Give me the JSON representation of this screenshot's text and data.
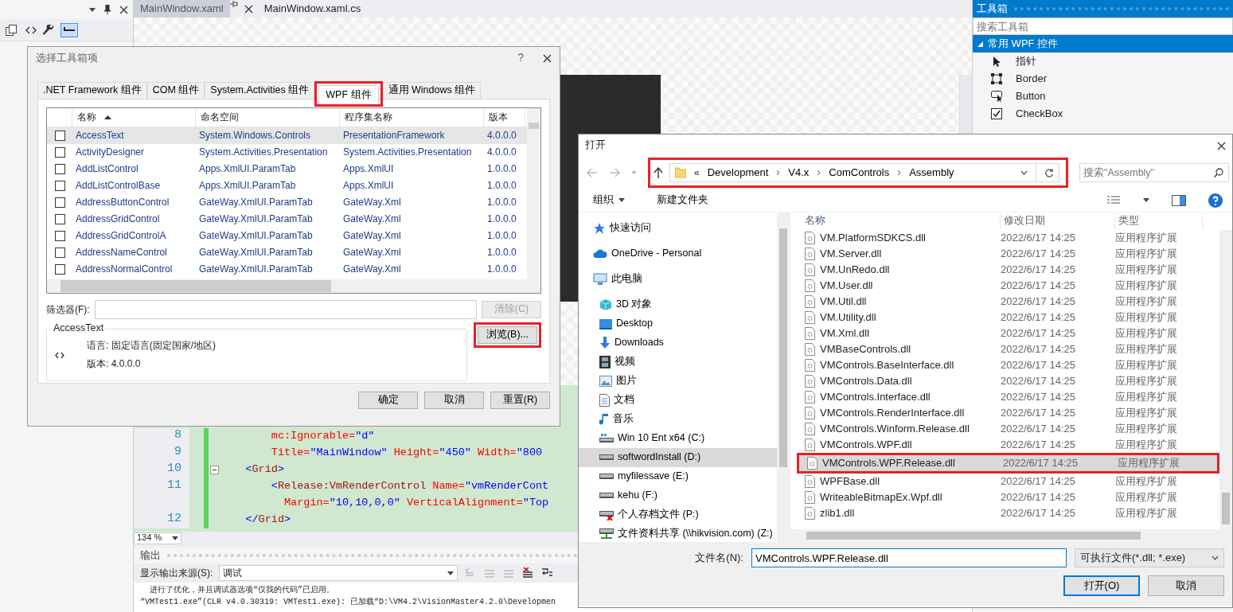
{
  "ide": {
    "editor_tabs": [
      {
        "label": "MainWindow.xaml",
        "selected": true
      },
      {
        "label": "MainWindow.xaml.cs",
        "selected": false
      }
    ],
    "code_lines": [
      {
        "number": "8",
        "fold": false,
        "segments": [
          {
            "kind": "attr",
            "text": "        mc:Ignorable="
          },
          {
            "kind": "value",
            "text": "\"d\""
          }
        ]
      },
      {
        "number": "9",
        "fold": false,
        "segments": [
          {
            "kind": "attr",
            "text": "        Title="
          },
          {
            "kind": "value",
            "text": "\"MainWindow\""
          },
          {
            "kind": "attr",
            "text": " Height="
          },
          {
            "kind": "value",
            "text": "\"450\""
          },
          {
            "kind": "attr",
            "text": " Width="
          },
          {
            "kind": "value",
            "text": "\"800"
          }
        ]
      },
      {
        "number": "10",
        "fold": true,
        "segments": [
          {
            "kind": "bracket",
            "text": "    <"
          },
          {
            "kind": "tag",
            "text": "Grid"
          },
          {
            "kind": "bracket",
            "text": ">"
          }
        ]
      },
      {
        "number": "11",
        "fold": false,
        "segments": [
          {
            "kind": "bracket",
            "text": "        <"
          },
          {
            "kind": "tag",
            "text": "Release:VmRenderControl"
          },
          {
            "kind": "attr",
            "text": " Name="
          },
          {
            "kind": "value",
            "text": "\"vmRenderCont"
          }
        ]
      },
      {
        "fold": false,
        "segments": [
          {
            "kind": "attr",
            "text": "          Margin="
          },
          {
            "kind": "value",
            "text": "\"10,10,0,0\""
          },
          {
            "kind": "attr",
            "text": " VerticalAlignment="
          },
          {
            "kind": "value",
            "text": "\"Top"
          }
        ]
      },
      {
        "number": "12",
        "fold": false,
        "segments": [
          {
            "kind": "bracket",
            "text": "    </"
          },
          {
            "kind": "tag",
            "text": "Grid"
          },
          {
            "kind": "bracket",
            "text": ">"
          }
        ]
      }
    ],
    "zoom": "134 %",
    "output": {
      "title": "输出",
      "source_label": "显示输出来源(S):",
      "source_value": "调试",
      "lines": [
        "  进行了优化，并且调试器选项“仅我的代码”已启用。",
        "“VMTest1.exe”(CLR v4.0.30319: VMTest1.exe): 已加载“D:\\VM4.2\\VisionMaster4.2.0\\Developmen"
      ]
    },
    "toolbox": {
      "title": "工具箱",
      "search_placeholder": "搜索工具箱",
      "group": {
        "label": "常用 WPF 控件",
        "expanded": true
      },
      "items": [
        {
          "label": "指针"
        },
        {
          "label": "Border"
        },
        {
          "label": "Button"
        },
        {
          "label": "CheckBox"
        }
      ]
    }
  },
  "choose_items_dialog": {
    "title": "选择工具箱项",
    "help": "?",
    "tabs": [
      {
        "label": ".NET Framework 组件",
        "selected": false,
        "highlighted": false
      },
      {
        "label": "COM 组件",
        "selected": false,
        "highlighted": false
      },
      {
        "label": "System.Activities 组件",
        "selected": false,
        "highlighted": false
      },
      {
        "label": "WPF 组件",
        "selected": true,
        "highlighted": true
      },
      {
        "label": "通用 Windows 组件",
        "selected": false,
        "highlighted": false
      }
    ],
    "columns": [
      "名称",
      "命名空间",
      "程序集名称",
      "版本"
    ],
    "rows": [
      {
        "checked": false,
        "selected": true,
        "name": "AccessText",
        "namespace": "System.Windows.Controls",
        "assembly": "PresentationFramework",
        "version": "4.0.0.0"
      },
      {
        "checked": false,
        "selected": false,
        "name": "ActivityDesigner",
        "namespace": "System.Activities.Presentation",
        "assembly": "System.Activities.Presentation",
        "version": "4.0.0.0"
      },
      {
        "checked": false,
        "selected": false,
        "name": "AddListControl",
        "namespace": "Apps.XmlUI.ParamTab",
        "assembly": "Apps.XmlUI",
        "version": "1.0.0.0"
      },
      {
        "checked": false,
        "selected": false,
        "name": "AddListControlBase",
        "namespace": "Apps.XmlUI.ParamTab",
        "assembly": "Apps.XmlUI",
        "version": "1.0.0.0"
      },
      {
        "checked": false,
        "selected": false,
        "name": "AddressButtonControl",
        "namespace": "GateWay.XmlUI.ParamTab",
        "assembly": "GateWay.Xml",
        "version": "1.0.0.0"
      },
      {
        "checked": false,
        "selected": false,
        "name": "AddressGridControl",
        "namespace": "GateWay.XmlUI.ParamTab",
        "assembly": "GateWay.Xml",
        "version": "1.0.0.0"
      },
      {
        "checked": false,
        "selected": false,
        "name": "AddressGridControlA",
        "namespace": "GateWay.XmlUI.ParamTab",
        "assembly": "GateWay.Xml",
        "version": "1.0.0.0"
      },
      {
        "checked": false,
        "selected": false,
        "name": "AddressNameControl",
        "namespace": "GateWay.XmlUI.ParamTab",
        "assembly": "GateWay.Xml",
        "version": "1.0.0.0"
      },
      {
        "checked": false,
        "selected": false,
        "name": "AddressNormalControl",
        "namespace": "GateWay.XmlUI.ParamTab",
        "assembly": "GateWay.Xml",
        "version": "1.0.0.0"
      }
    ],
    "filter_label": "筛选器(F):",
    "clear_button": {
      "label": "清除(C)",
      "disabled": true
    },
    "browse_button": {
      "label": "浏览(B)...",
      "highlighted": true
    },
    "info": {
      "title": "AccessText",
      "language": "语言: 固定语言(固定国家/地区)",
      "version": "版本: 4.0.0.0"
    },
    "buttons": [
      "确定",
      "取消",
      "重置(R)"
    ]
  },
  "open_dialog": {
    "title": "打开",
    "path": {
      "prefix": "«",
      "crumbs": [
        "Development",
        "V4.x",
        "ComControls",
        "Assembly"
      ],
      "highlighted": true
    },
    "search_placeholder": "搜索\"Assembly\"",
    "toolbar": {
      "organize": "组织",
      "new_folder": "新建文件夹"
    },
    "nav": [
      {
        "label": "快速访问",
        "selected": false
      },
      {
        "label": "OneDrive - Personal",
        "selected": false
      },
      {
        "label": "此电脑",
        "selected": false,
        "children": [
          {
            "label": "3D 对象",
            "selected": false
          },
          {
            "label": "Desktop",
            "selected": false
          },
          {
            "label": "Downloads",
            "selected": false
          },
          {
            "label": "视频",
            "selected": false
          },
          {
            "label": "图片",
            "selected": false
          },
          {
            "label": "文档",
            "selected": false
          },
          {
            "label": "音乐",
            "selected": false
          },
          {
            "label": "Win 10 Ent x64 (C:)",
            "selected": false
          },
          {
            "label": "softwordInstall (D:)",
            "selected": true
          },
          {
            "label": "myfilessave (E:)",
            "selected": false
          },
          {
            "label": "kehu (F:)",
            "selected": false
          },
          {
            "label": "个人存档文件 (P:)",
            "selected": false
          },
          {
            "label": "文件资料共享 (\\\\hikvision.com) (Z:)",
            "selected": false
          }
        ]
      }
    ],
    "columns": [
      "名称",
      "修改日期",
      "类型"
    ],
    "files": [
      {
        "name": "VM.PlatformSDKCS.dll",
        "date": "2022/6/17 14:25",
        "type": "应用程序扩展",
        "selected": false,
        "highlighted": false
      },
      {
        "name": "VM.Server.dll",
        "date": "2022/6/17 14:25",
        "type": "应用程序扩展",
        "selected": false,
        "highlighted": false
      },
      {
        "name": "VM.UnRedo.dll",
        "date": "2022/6/17 14:25",
        "type": "应用程序扩展",
        "selected": false,
        "highlighted": false
      },
      {
        "name": "VM.User.dll",
        "date": "2022/6/17 14:25",
        "type": "应用程序扩展",
        "selected": false,
        "highlighted": false
      },
      {
        "name": "VM.Util.dll",
        "date": "2022/6/17 14:25",
        "type": "应用程序扩展",
        "selected": false,
        "highlighted": false
      },
      {
        "name": "VM.Utility.dll",
        "date": "2022/6/17 14:25",
        "type": "应用程序扩展",
        "selected": false,
        "highlighted": false
      },
      {
        "name": "VM.Xml.dll",
        "date": "2022/6/17 14:25",
        "type": "应用程序扩展",
        "selected": false,
        "highlighted": false
      },
      {
        "name": "VMBaseControls.dll",
        "date": "2022/6/17 14:25",
        "type": "应用程序扩展",
        "selected": false,
        "highlighted": false
      },
      {
        "name": "VMControls.BaseInterface.dll",
        "date": "2022/6/17 14:25",
        "type": "应用程序扩展",
        "selected": false,
        "highlighted": false
      },
      {
        "name": "VMControls.Data.dll",
        "date": "2022/6/17 14:25",
        "type": "应用程序扩展",
        "selected": false,
        "highlighted": false
      },
      {
        "name": "VMControls.Interface.dll",
        "date": "2022/6/17 14:25",
        "type": "应用程序扩展",
        "selected": false,
        "highlighted": false
      },
      {
        "name": "VMControls.RenderInterface.dll",
        "date": "2022/6/17 14:25",
        "type": "应用程序扩展",
        "selected": false,
        "highlighted": false
      },
      {
        "name": "VMControls.Winform.Release.dll",
        "date": "2022/6/17 14:25",
        "type": "应用程序扩展",
        "selected": false,
        "highlighted": false
      },
      {
        "name": "VMControls.WPF.dll",
        "date": "2022/6/17 14:25",
        "type": "应用程序扩展",
        "selected": false,
        "highlighted": false
      },
      {
        "name": "VMControls.WPF.Release.dll",
        "date": "2022/6/17 14:25",
        "type": "应用程序扩展",
        "selected": true,
        "highlighted": true
      },
      {
        "name": "WPFBase.dll",
        "date": "2022/6/17 14:25",
        "type": "应用程序扩展",
        "selected": false,
        "highlighted": false
      },
      {
        "name": "WriteableBitmapEx.Wpf.dll",
        "date": "2022/6/17 14:25",
        "type": "应用程序扩展",
        "selected": false,
        "highlighted": false
      },
      {
        "name": "zlib1.dll",
        "date": "2022/6/17 14:25",
        "type": "应用程序扩展",
        "selected": false,
        "highlighted": false
      }
    ],
    "filename_label": "文件名(N):",
    "filename_value": "VMControls.WPF.Release.dll",
    "file_type": "可执行文件(*.dll; *.exe)",
    "buttons": [
      {
        "label": "打开(O)",
        "kind": "primary"
      },
      {
        "label": "取消",
        "kind": "normal"
      }
    ]
  }
}
